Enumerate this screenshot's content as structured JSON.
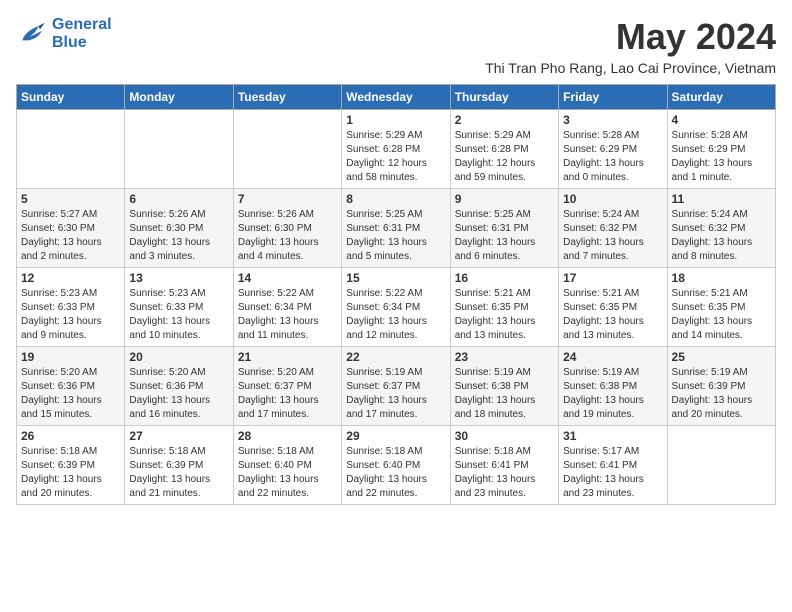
{
  "header": {
    "logo_line1": "General",
    "logo_line2": "Blue",
    "month_year": "May 2024",
    "location": "Thi Tran Pho Rang, Lao Cai Province, Vietnam"
  },
  "weekdays": [
    "Sunday",
    "Monday",
    "Tuesday",
    "Wednesday",
    "Thursday",
    "Friday",
    "Saturday"
  ],
  "weeks": [
    [
      {
        "day": "",
        "info": ""
      },
      {
        "day": "",
        "info": ""
      },
      {
        "day": "",
        "info": ""
      },
      {
        "day": "1",
        "info": "Sunrise: 5:29 AM\nSunset: 6:28 PM\nDaylight: 12 hours and 58 minutes."
      },
      {
        "day": "2",
        "info": "Sunrise: 5:29 AM\nSunset: 6:28 PM\nDaylight: 12 hours and 59 minutes."
      },
      {
        "day": "3",
        "info": "Sunrise: 5:28 AM\nSunset: 6:29 PM\nDaylight: 13 hours and 0 minutes."
      },
      {
        "day": "4",
        "info": "Sunrise: 5:28 AM\nSunset: 6:29 PM\nDaylight: 13 hours and 1 minute."
      }
    ],
    [
      {
        "day": "5",
        "info": "Sunrise: 5:27 AM\nSunset: 6:30 PM\nDaylight: 13 hours and 2 minutes."
      },
      {
        "day": "6",
        "info": "Sunrise: 5:26 AM\nSunset: 6:30 PM\nDaylight: 13 hours and 3 minutes."
      },
      {
        "day": "7",
        "info": "Sunrise: 5:26 AM\nSunset: 6:30 PM\nDaylight: 13 hours and 4 minutes."
      },
      {
        "day": "8",
        "info": "Sunrise: 5:25 AM\nSunset: 6:31 PM\nDaylight: 13 hours and 5 minutes."
      },
      {
        "day": "9",
        "info": "Sunrise: 5:25 AM\nSunset: 6:31 PM\nDaylight: 13 hours and 6 minutes."
      },
      {
        "day": "10",
        "info": "Sunrise: 5:24 AM\nSunset: 6:32 PM\nDaylight: 13 hours and 7 minutes."
      },
      {
        "day": "11",
        "info": "Sunrise: 5:24 AM\nSunset: 6:32 PM\nDaylight: 13 hours and 8 minutes."
      }
    ],
    [
      {
        "day": "12",
        "info": "Sunrise: 5:23 AM\nSunset: 6:33 PM\nDaylight: 13 hours and 9 minutes."
      },
      {
        "day": "13",
        "info": "Sunrise: 5:23 AM\nSunset: 6:33 PM\nDaylight: 13 hours and 10 minutes."
      },
      {
        "day": "14",
        "info": "Sunrise: 5:22 AM\nSunset: 6:34 PM\nDaylight: 13 hours and 11 minutes."
      },
      {
        "day": "15",
        "info": "Sunrise: 5:22 AM\nSunset: 6:34 PM\nDaylight: 13 hours and 12 minutes."
      },
      {
        "day": "16",
        "info": "Sunrise: 5:21 AM\nSunset: 6:35 PM\nDaylight: 13 hours and 13 minutes."
      },
      {
        "day": "17",
        "info": "Sunrise: 5:21 AM\nSunset: 6:35 PM\nDaylight: 13 hours and 13 minutes."
      },
      {
        "day": "18",
        "info": "Sunrise: 5:21 AM\nSunset: 6:35 PM\nDaylight: 13 hours and 14 minutes."
      }
    ],
    [
      {
        "day": "19",
        "info": "Sunrise: 5:20 AM\nSunset: 6:36 PM\nDaylight: 13 hours and 15 minutes."
      },
      {
        "day": "20",
        "info": "Sunrise: 5:20 AM\nSunset: 6:36 PM\nDaylight: 13 hours and 16 minutes."
      },
      {
        "day": "21",
        "info": "Sunrise: 5:20 AM\nSunset: 6:37 PM\nDaylight: 13 hours and 17 minutes."
      },
      {
        "day": "22",
        "info": "Sunrise: 5:19 AM\nSunset: 6:37 PM\nDaylight: 13 hours and 17 minutes."
      },
      {
        "day": "23",
        "info": "Sunrise: 5:19 AM\nSunset: 6:38 PM\nDaylight: 13 hours and 18 minutes."
      },
      {
        "day": "24",
        "info": "Sunrise: 5:19 AM\nSunset: 6:38 PM\nDaylight: 13 hours and 19 minutes."
      },
      {
        "day": "25",
        "info": "Sunrise: 5:19 AM\nSunset: 6:39 PM\nDaylight: 13 hours and 20 minutes."
      }
    ],
    [
      {
        "day": "26",
        "info": "Sunrise: 5:18 AM\nSunset: 6:39 PM\nDaylight: 13 hours and 20 minutes."
      },
      {
        "day": "27",
        "info": "Sunrise: 5:18 AM\nSunset: 6:39 PM\nDaylight: 13 hours and 21 minutes."
      },
      {
        "day": "28",
        "info": "Sunrise: 5:18 AM\nSunset: 6:40 PM\nDaylight: 13 hours and 22 minutes."
      },
      {
        "day": "29",
        "info": "Sunrise: 5:18 AM\nSunset: 6:40 PM\nDaylight: 13 hours and 22 minutes."
      },
      {
        "day": "30",
        "info": "Sunrise: 5:18 AM\nSunset: 6:41 PM\nDaylight: 13 hours and 23 minutes."
      },
      {
        "day": "31",
        "info": "Sunrise: 5:17 AM\nSunset: 6:41 PM\nDaylight: 13 hours and 23 minutes."
      },
      {
        "day": "",
        "info": ""
      }
    ]
  ]
}
